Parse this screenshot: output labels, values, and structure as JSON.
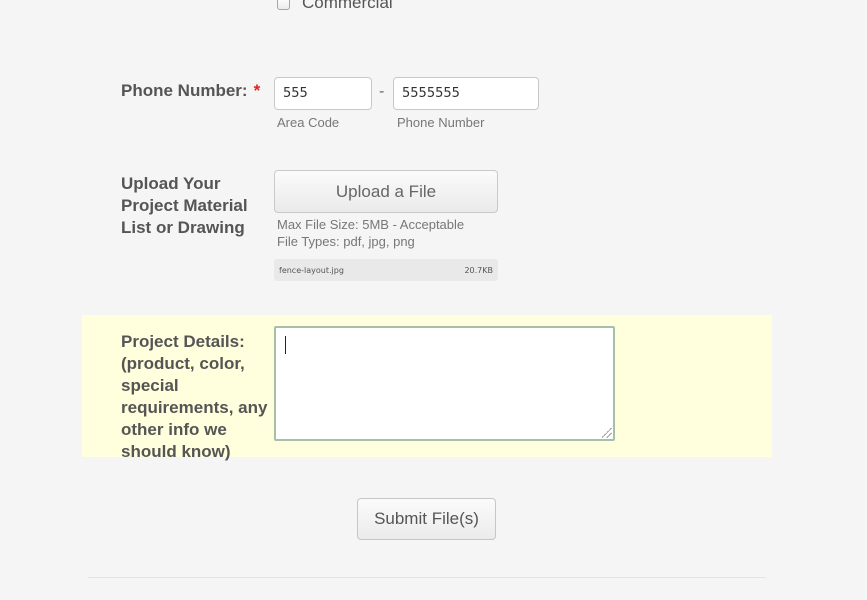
{
  "commercial": {
    "label": "Commercial",
    "checked": false
  },
  "phone": {
    "label": "Phone Number:",
    "required_mark": "*",
    "area_code_value": "555",
    "area_code_sublabel": "Area Code",
    "separator": "-",
    "number_value": "5555555",
    "number_sublabel": "Phone Number"
  },
  "upload": {
    "label_line1": "Upload Your",
    "label_line2": "Project Material",
    "label_line3": "List or Drawing",
    "button_label": "Upload a File",
    "note_line1": "Max File Size: 5MB - Acceptable",
    "note_line2": "File Types: pdf, jpg, png",
    "file_name": "fence-layout.jpg",
    "file_size": "20.7KB"
  },
  "details": {
    "label_line1": "Project Details:",
    "label_line2": "(product, color,",
    "label_line3": "special",
    "label_line4": "requirements, any",
    "label_line5": "other info we",
    "label_line6": "should know)",
    "value": ""
  },
  "submit": {
    "label": "Submit File(s)"
  },
  "colors": {
    "highlight_band": "#ffffde",
    "required": "#e02020",
    "textarea_border": "#a7bfa7"
  }
}
